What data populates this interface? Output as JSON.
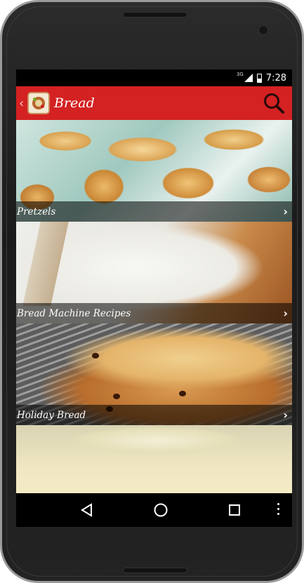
{
  "status_bar": {
    "network": "3G",
    "time": "7:28"
  },
  "app_bar": {
    "title": "Bread",
    "back_icon": "chevron-left-icon",
    "search_icon": "search-icon",
    "accent_color": "#d42122"
  },
  "categories": [
    {
      "label": "Pretzels"
    },
    {
      "label": "Bread Machine Recipes"
    },
    {
      "label": "Holiday Bread"
    },
    {
      "label": ""
    }
  ],
  "nav_bar": {
    "back_icon": "back-triangle-icon",
    "home_icon": "home-circle-icon",
    "recents_icon": "recents-square-icon",
    "menu_icon": "overflow-menu-icon"
  }
}
